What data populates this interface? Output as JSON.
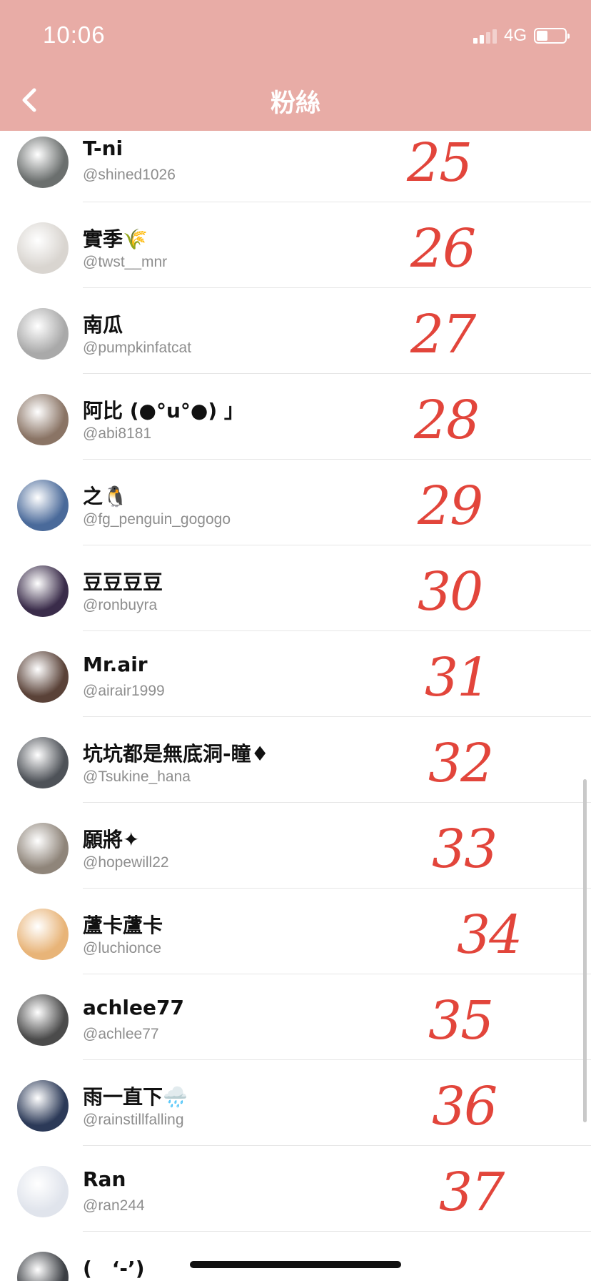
{
  "status_bar": {
    "time": "10:06",
    "network": "4G",
    "battery_level": 0.4
  },
  "nav": {
    "title": "粉絲"
  },
  "colors": {
    "header_bg": "#e8aca6",
    "annotation": "#e2453b"
  },
  "followers": [
    {
      "name": "T-ni",
      "handle": "@shined1026",
      "mark": "25",
      "avatar_color": "#6b6f6e"
    },
    {
      "name": "實季🌾",
      "handle": "@twst__mnr",
      "mark": "26",
      "avatar_color": "#d9d5d0"
    },
    {
      "name": "南瓜",
      "handle": "@pumpkinfatcat",
      "mark": "27",
      "avatar_color": "#a9a9a9"
    },
    {
      "name": "阿比 (●°u°●) 」",
      "handle": "@abi8181",
      "mark": "28",
      "avatar_color": "#8a7465"
    },
    {
      "name": "之🐧",
      "handle": "@fg_penguin_gogogo",
      "mark": "29",
      "avatar_color": "#4a6a9a"
    },
    {
      "name": "豆豆豆豆",
      "handle": "@ronbuyra",
      "mark": "30",
      "avatar_color": "#3a2c4a"
    },
    {
      "name": "Mr.air",
      "handle": "@airair1999",
      "mark": "31",
      "avatar_color": "#5a4238"
    },
    {
      "name": "坑坑都是無底洞-瞳♦",
      "handle": "@Tsukine_hana",
      "mark": "32",
      "avatar_color": "#4e5258"
    },
    {
      "name": "願將✦",
      "handle": "@hopewill22",
      "mark": "33",
      "avatar_color": "#8f857a"
    },
    {
      "name": "蘆卡蘆卡",
      "handle": "@luchionce",
      "mark": "34",
      "avatar_color": "#e8b478"
    },
    {
      "name": "achlee77",
      "handle": "@achlee77",
      "mark": "35",
      "avatar_color": "#4b4b4b"
    },
    {
      "name": "雨一直下🌧️",
      "handle": "@rainstillfalling",
      "mark": "36",
      "avatar_color": "#2c3a58"
    },
    {
      "name": "Ran",
      "handle": "@ran244",
      "mark": "37",
      "avatar_color": "#e0e4ec"
    },
    {
      "name": "(　‘-’)",
      "handle": "",
      "mark": "",
      "avatar_color": "#3c3f44"
    }
  ]
}
